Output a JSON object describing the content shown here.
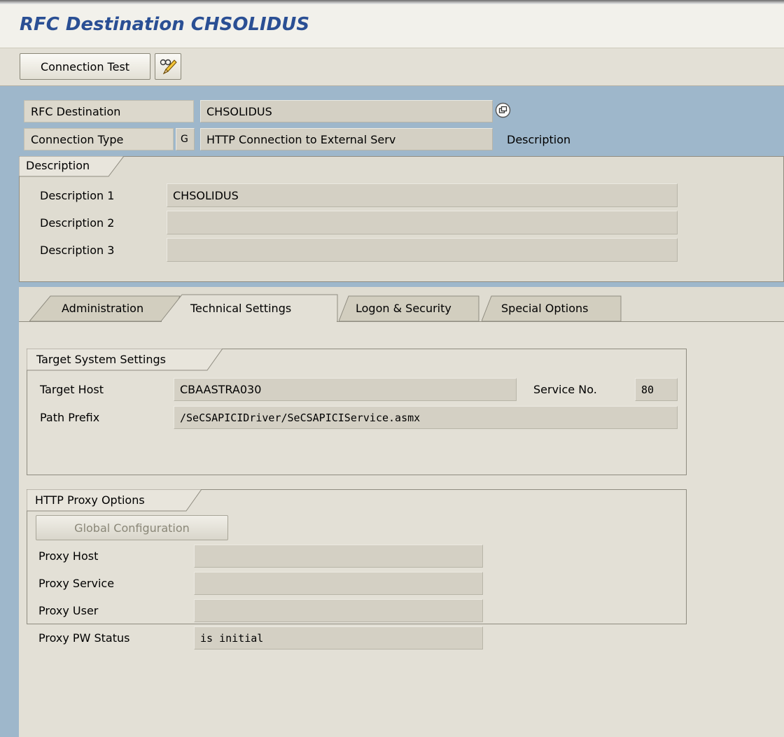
{
  "title": "RFC Destination CHSOLIDUS",
  "toolbar": {
    "connection_test": "Connection Test",
    "edit_icon": "pencil-glasses-icon"
  },
  "header": {
    "rfc_destination_label": "RFC Destination",
    "rfc_destination_value": "CHSOLIDUS",
    "connection_type_label": "Connection Type",
    "connection_type_code": "G",
    "connection_type_value": "HTTP Connection to External Serv",
    "description_link": "Description"
  },
  "description": {
    "group_title": "Description",
    "rows": [
      {
        "label": "Description 1",
        "value": "CHSOLIDUS"
      },
      {
        "label": "Description 2",
        "value": ""
      },
      {
        "label": "Description 3",
        "value": ""
      }
    ]
  },
  "tabs": [
    {
      "label": "Administration"
    },
    {
      "label": "Technical Settings",
      "active": true
    },
    {
      "label": "Logon & Security"
    },
    {
      "label": "Special Options"
    }
  ],
  "target": {
    "group_title": "Target System Settings",
    "target_host_label": "Target Host",
    "target_host_value": "CBAASTRA030",
    "service_no_label": "Service No.",
    "service_no_value": "80",
    "path_prefix_label": "Path Prefix",
    "path_prefix_value": "/SeCSAPICIDriver/SeCSAPICIService.asmx"
  },
  "proxy": {
    "group_title": "HTTP Proxy Options",
    "global_config_label": "Global Configuration",
    "rows": [
      {
        "label": "Proxy Host",
        "value": ""
      },
      {
        "label": "Proxy Service",
        "value": ""
      },
      {
        "label": "Proxy User",
        "value": ""
      },
      {
        "label": "Proxy PW Status",
        "value": "is initial"
      }
    ]
  },
  "colors": {
    "title": "#2a4f94",
    "header_bg": "#9eb7cb",
    "panel_bg": "#e3e0d6"
  }
}
